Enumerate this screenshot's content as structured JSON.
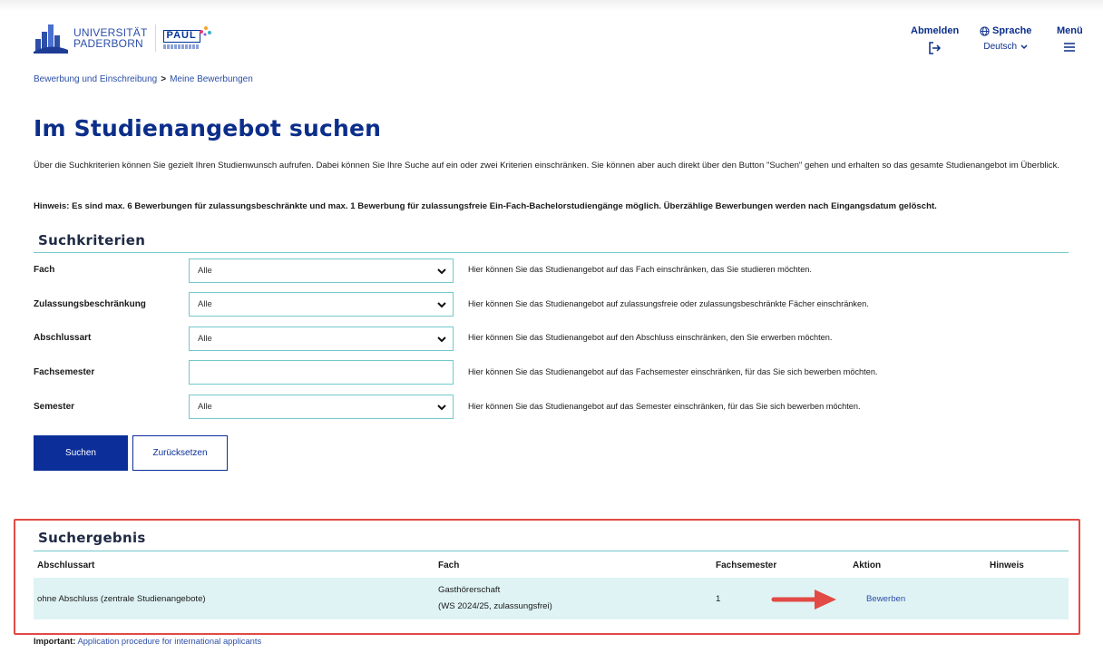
{
  "header": {
    "university_line1": "UNIVERSITÄT",
    "university_line2": "PADERBORN",
    "paul_logo": "PAUL",
    "logout_label": "Abmelden",
    "language_label": "Sprache",
    "language_value": "Deutsch",
    "menu_label": "Menü"
  },
  "breadcrumb": {
    "item1": "Bewerbung und Einschreibung",
    "separator": ">",
    "item2": "Meine Bewerbungen"
  },
  "page": {
    "title": "Im Studienangebot suchen",
    "intro": "Über die Suchkriterien können Sie gezielt Ihren Studienwunsch aufrufen. Dabei können Sie Ihre Suche auf ein oder zwei Kriterien einschränken. Sie können aber auch direkt über den Button \"Suchen\" gehen und erhalten so das gesamte Studienangebot im Überblick.",
    "hint": "Hinweis: Es sind max. 6 Bewerbungen für zulassungsbeschränkte und max. 1 Bewerbung für zulassungsfreie Ein-Fach-Bachelorstudiengänge möglich. Überzählige Bewerbungen werden nach Eingangsdatum gelöscht."
  },
  "criteria": {
    "title": "Suchkriterien",
    "rows": [
      {
        "label": "Fach",
        "value": "Alle",
        "help": "Hier können Sie das Studienangebot auf das Fach einschränken, das Sie studieren möchten."
      },
      {
        "label": "Zulassungsbeschränkung",
        "value": "Alle",
        "help": "Hier können Sie das Studienangebot auf zulassungsfreie oder zulassungsbeschränkte Fächer einschränken."
      },
      {
        "label": "Abschlussart",
        "value": "Alle",
        "help": "Hier können Sie das Studienangebot auf den Abschluss einschränken, den Sie erwerben möchten."
      },
      {
        "label": "Fachsemester",
        "value": "",
        "help": "Hier können Sie das Studienangebot auf das Fachsemester einschränken, für das Sie sich bewerben möchten."
      },
      {
        "label": "Semester",
        "value": "Alle",
        "help": "Hier können Sie das Studienangebot auf das Semester einschränken, für das Sie sich bewerben möchten."
      }
    ],
    "search_button": "Suchen",
    "reset_button": "Zurücksetzen"
  },
  "results": {
    "title": "Suchergebnis",
    "columns": [
      "Abschlussart",
      "Fach",
      "Fachsemester",
      "Aktion",
      "Hinweis"
    ],
    "rows": [
      {
        "abschlussart": "ohne Abschluss (zentrale Studienangebote)",
        "fach_line1": "Gasthörerschaft",
        "fach_line2": "(WS 2024/25, zulassungsfrei)",
        "fachsemester": "1",
        "aktion": "Bewerben",
        "hinweis": ""
      }
    ]
  },
  "footer": {
    "important_label": "Important:",
    "important_link": "Application procedure for international applicants"
  },
  "colors": {
    "brand_blue": "#0b2e99",
    "accent_teal": "#73c8cc",
    "row_highlight": "#dff3f4",
    "annotation_red": "#e24a45"
  },
  "icons": [
    "university-logo-icon",
    "logout-icon",
    "globe-icon",
    "chevron-down-icon",
    "hamburger-menu-icon",
    "annotation-arrow-icon"
  ]
}
